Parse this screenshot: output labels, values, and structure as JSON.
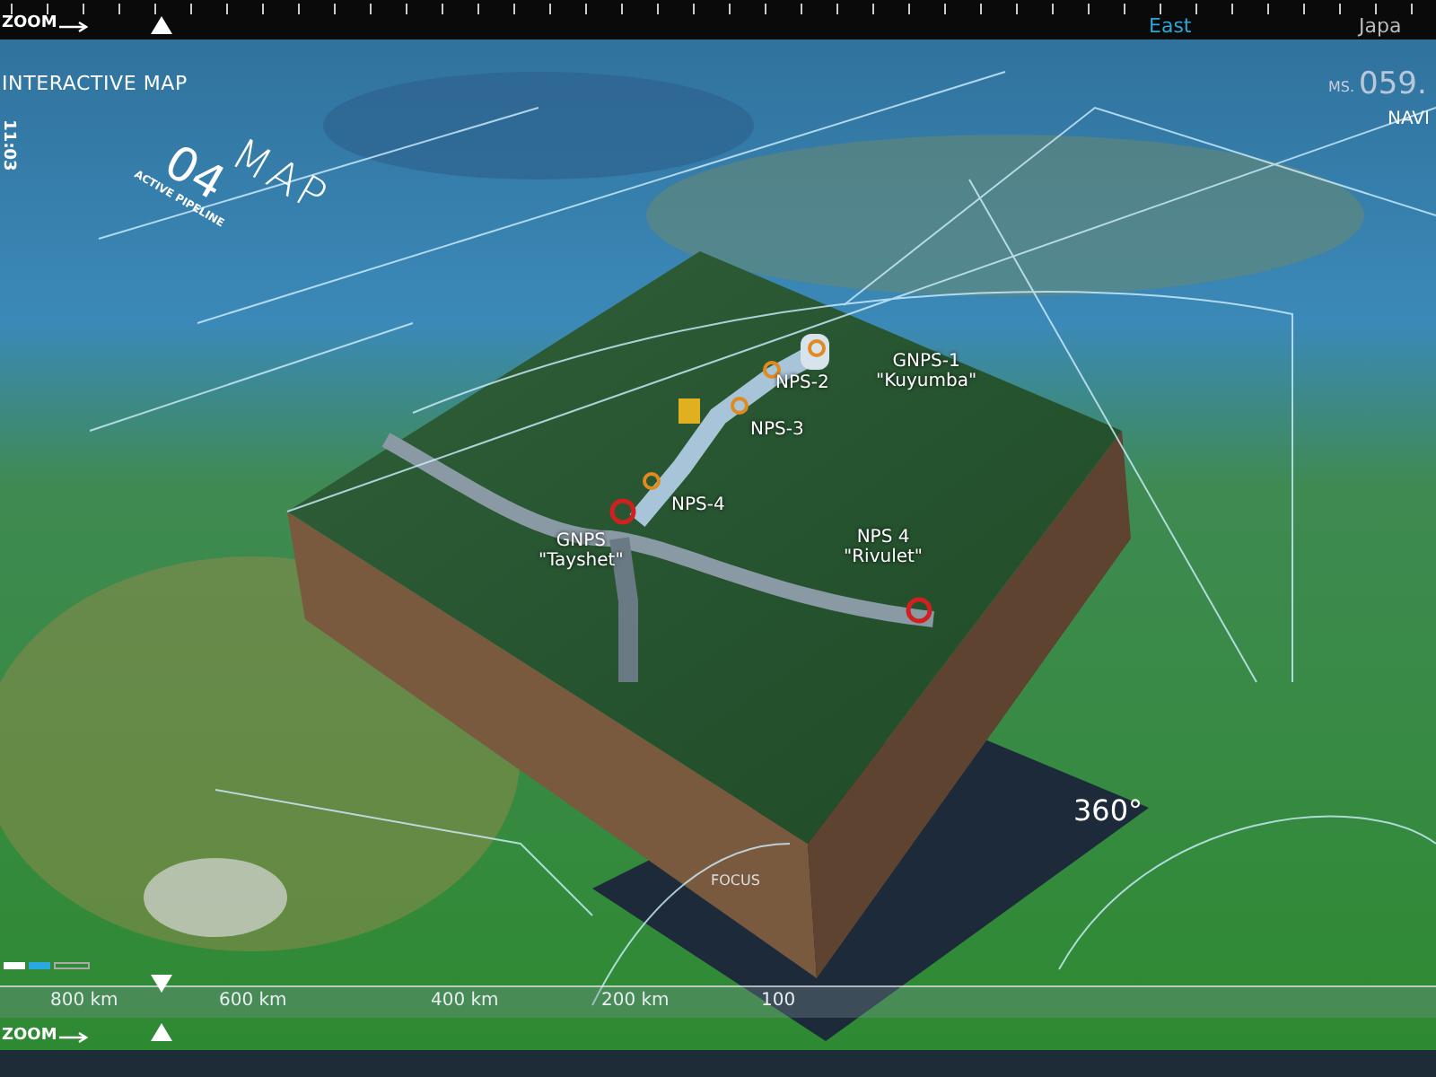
{
  "top_bar": {
    "zoom_label": "ZOOM",
    "region_labels": [
      "East",
      "Japa"
    ]
  },
  "header": {
    "title": "INTERACTIVE MAP",
    "time": "11:03",
    "ms_label": "MS.",
    "ms_value": "059.",
    "nav_label": "NAVI"
  },
  "map_badge": {
    "title": "MAP",
    "number": "04",
    "subtitle": "ACTIVE PIPELINE"
  },
  "stations": [
    {
      "name": "NPS-2"
    },
    {
      "name": "NPS-3"
    },
    {
      "name": "NPS-4"
    },
    {
      "name": "GNPS-1",
      "alias": "\"Kuyumba\""
    },
    {
      "name": "GNPS",
      "alias": "\"Tayshet\""
    },
    {
      "name": "NPS 4",
      "alias": "\"Rivulet\""
    }
  ],
  "focus_label": "FOCUS",
  "rotation": "360°",
  "scale_bar": {
    "ticks": [
      "800 km",
      "600 km",
      "400 km",
      "200 km",
      "100"
    ]
  },
  "bottom_bar": {
    "zoom_label": "ZOOM"
  }
}
